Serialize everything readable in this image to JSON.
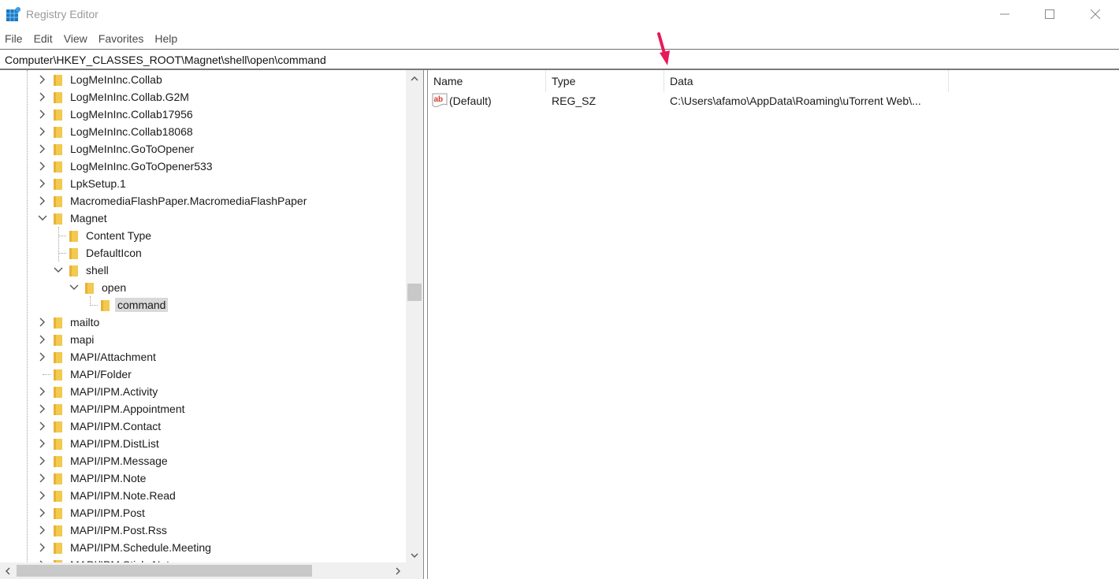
{
  "window": {
    "title": "Registry Editor",
    "icon": "registry-editor-icon",
    "controls": [
      "minimize",
      "maximize",
      "close"
    ]
  },
  "menu": {
    "items": [
      "File",
      "Edit",
      "View",
      "Favorites",
      "Help"
    ]
  },
  "address": {
    "path": "Computer\\HKEY_CLASSES_ROOT\\Magnet\\shell\\open\\command"
  },
  "tree": {
    "items": [
      {
        "label": "LogMeInInc.Collab",
        "level": 0,
        "state": "collapsed"
      },
      {
        "label": "LogMeInInc.Collab.G2M",
        "level": 0,
        "state": "collapsed"
      },
      {
        "label": "LogMeInInc.Collab17956",
        "level": 0,
        "state": "collapsed"
      },
      {
        "label": "LogMeInInc.Collab18068",
        "level": 0,
        "state": "collapsed"
      },
      {
        "label": "LogMeInInc.GoToOpener",
        "level": 0,
        "state": "collapsed"
      },
      {
        "label": "LogMeInInc.GoToOpener533",
        "level": 0,
        "state": "collapsed"
      },
      {
        "label": "LpkSetup.1",
        "level": 0,
        "state": "collapsed"
      },
      {
        "label": "MacromediaFlashPaper.MacromediaFlashPaper",
        "level": 0,
        "state": "collapsed"
      },
      {
        "label": "Magnet",
        "level": 0,
        "state": "expanded"
      },
      {
        "label": "Content Type",
        "level": 1,
        "state": "leaf"
      },
      {
        "label": "DefaultIcon",
        "level": 1,
        "state": "leaf"
      },
      {
        "label": "shell",
        "level": 1,
        "state": "expanded"
      },
      {
        "label": "open",
        "level": 2,
        "state": "expanded"
      },
      {
        "label": "command",
        "level": 3,
        "state": "leaf",
        "selected": true
      },
      {
        "label": "mailto",
        "level": 0,
        "state": "collapsed"
      },
      {
        "label": "mapi",
        "level": 0,
        "state": "collapsed"
      },
      {
        "label": "MAPI/Attachment",
        "level": 0,
        "state": "collapsed"
      },
      {
        "label": "MAPI/Folder",
        "level": 0,
        "state": "leaf"
      },
      {
        "label": "MAPI/IPM.Activity",
        "level": 0,
        "state": "collapsed"
      },
      {
        "label": "MAPI/IPM.Appointment",
        "level": 0,
        "state": "collapsed"
      },
      {
        "label": "MAPI/IPM.Contact",
        "level": 0,
        "state": "collapsed"
      },
      {
        "label": "MAPI/IPM.DistList",
        "level": 0,
        "state": "collapsed"
      },
      {
        "label": "MAPI/IPM.Message",
        "level": 0,
        "state": "collapsed"
      },
      {
        "label": "MAPI/IPM.Note",
        "level": 0,
        "state": "collapsed"
      },
      {
        "label": "MAPI/IPM.Note.Read",
        "level": 0,
        "state": "collapsed"
      },
      {
        "label": "MAPI/IPM.Post",
        "level": 0,
        "state": "collapsed"
      },
      {
        "label": "MAPI/IPM.Post.Rss",
        "level": 0,
        "state": "collapsed"
      },
      {
        "label": "MAPI/IPM.Schedule.Meeting",
        "level": 0,
        "state": "collapsed"
      },
      {
        "label": "MAPI/IPM.StickyNote",
        "level": 0,
        "state": "collapsed"
      }
    ]
  },
  "values": {
    "columns": {
      "name": "Name",
      "type": "Type",
      "data": "Data"
    },
    "rows": [
      {
        "name": "(Default)",
        "type": "REG_SZ",
        "data": "C:\\Users\\afamo\\AppData\\Roaming\\uTorrent Web\\...",
        "icon": "string-value-icon"
      }
    ]
  },
  "annotation": {
    "arrow_color": "#e8195a",
    "points_to": "Data column"
  },
  "colors": {
    "folder": "#f3c94e",
    "selection": "#d9d9d9",
    "scrollbar_track": "#f0f0f0",
    "scrollbar_thumb": "#c8c8c8"
  }
}
